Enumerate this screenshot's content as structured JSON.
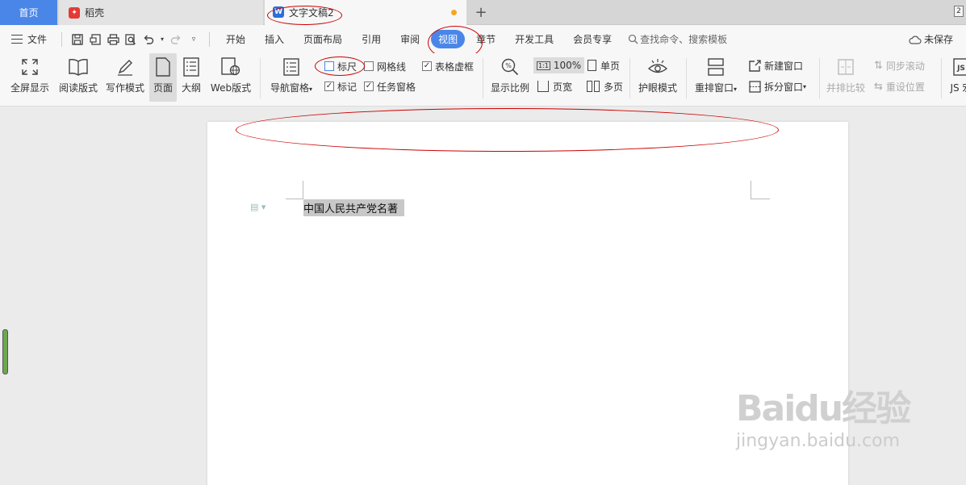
{
  "tabs": {
    "home": "首页",
    "daoke": "稻壳",
    "doc": "文字文稿2",
    "add": "+",
    "window_count": "2"
  },
  "menu": {
    "file": "文件",
    "items": [
      "开始",
      "插入",
      "页面布局",
      "引用",
      "审阅",
      "视图",
      "章节",
      "开发工具",
      "会员专享"
    ],
    "active": "视图",
    "search": "查找命令、搜索模板",
    "unsaved": "未保存"
  },
  "ribbon": {
    "fullscreen": "全屏显示",
    "read": "阅读版式",
    "write": "写作模式",
    "page": "页面",
    "outline": "大纲",
    "web": "Web版式",
    "nav": "导航窗格",
    "ruler": "标尺",
    "gridlines": "网格线",
    "table_borders": "表格虚框",
    "marks": "标记",
    "task_pane": "任务窗格",
    "zoom": "显示比例",
    "zoom_100": "100%",
    "page_width": "页宽",
    "single_page": "单页",
    "multi_page": "多页",
    "eye": "护眼模式",
    "rearrange": "重排窗口",
    "new_window": "新建窗口",
    "split_window": "拆分窗口",
    "compare": "并排比较",
    "sync_scroll": "同步滚动",
    "reset_pos": "重设位置",
    "js": "JS 宏"
  },
  "document": {
    "text": "中国人民共产党名著"
  },
  "checkboxes": {
    "ruler": false,
    "gridlines": false,
    "table_borders": true,
    "marks": true,
    "task_pane": true
  },
  "watermark": {
    "logo": "Baidu经验",
    "url": "jingyan.baidu.com"
  },
  "colors": {
    "accent": "#4a86e8",
    "annotation": "#cc0000"
  }
}
